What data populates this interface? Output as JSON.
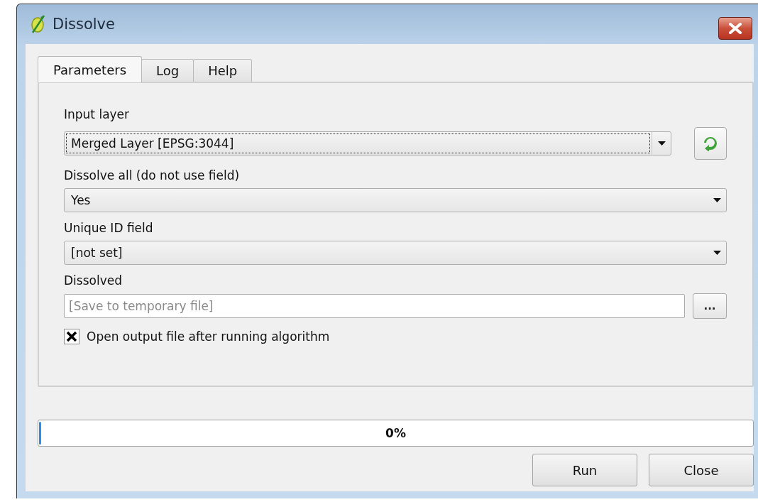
{
  "window": {
    "title": "Dissolve"
  },
  "tabs": [
    {
      "label": "Parameters",
      "selected": true
    },
    {
      "label": "Log",
      "selected": false
    },
    {
      "label": "Help",
      "selected": false
    }
  ],
  "parameters": [
    {
      "kind": "layer",
      "label": "Input layer",
      "value": "Merged Layer [EPSG:3044]",
      "focused": true
    },
    {
      "kind": "select",
      "label": "Dissolve all (do not use field)",
      "value": "Yes",
      "focused": false
    },
    {
      "kind": "select",
      "label": "Unique ID field",
      "value": "[not set]",
      "focused": false
    },
    {
      "kind": "output",
      "label": "Dissolved",
      "placeholder": "[Save to temporary file]",
      "browse": "..."
    }
  ],
  "open_output": {
    "label": "Open output file after running algorithm",
    "checked": true
  },
  "progress": {
    "level": 0,
    "text": "0%"
  },
  "buttons": [
    "Run",
    "Close"
  ]
}
